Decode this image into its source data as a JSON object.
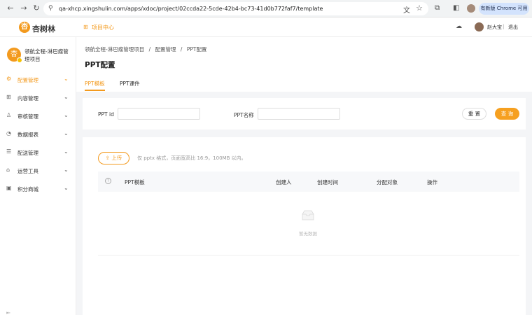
{
  "browser": {
    "url": "qa-xhcp.xingshulin.com/apps/xdoc/project/02ccda22-5cde-42b4-bc73-41d0b772faf7/template",
    "new_version": "有新版 Chrome 可用"
  },
  "header": {
    "brand": "杏树林",
    "project_center": "项目中心",
    "user_name": "赵大宝",
    "separator": "|",
    "logout": "退出"
  },
  "sidebar": {
    "project_name": "领航全程-淋巴瘤管理项目",
    "items": [
      {
        "label": "配置管理",
        "icon": "gear-icon",
        "active": true
      },
      {
        "label": "内容管理",
        "icon": "grid-icon",
        "active": false
      },
      {
        "label": "审核管理",
        "icon": "user-icon",
        "active": false
      },
      {
        "label": "数据报表",
        "icon": "pie-icon",
        "active": false
      },
      {
        "label": "配送管理",
        "icon": "list-icon",
        "active": false
      },
      {
        "label": "运营工具",
        "icon": "home-icon",
        "active": false
      },
      {
        "label": "积分商城",
        "icon": "store-icon",
        "active": false
      }
    ]
  },
  "main": {
    "breadcrumb": [
      "领航全程-淋巴瘤管理项目",
      "/",
      "配置管理",
      "/",
      "PPT配置"
    ],
    "title": "PPT配置",
    "tabs": [
      {
        "label": "PPT模板",
        "active": true
      },
      {
        "label": "PPT课件",
        "active": false
      }
    ],
    "filters": {
      "ppt_id_label": "PPT id",
      "ppt_id_value": "",
      "ppt_name_label": "PPT名称",
      "ppt_name_value": "",
      "reset_label": "重 置",
      "query_label": "查 询"
    },
    "upload": {
      "button_label": "上传",
      "hint": "仅 pptx 格式，页面宽高比 16:9，100MB 以内。"
    },
    "table": {
      "columns": [
        "PPT模板",
        "创建人",
        "创建时间",
        "分配对象",
        "操作"
      ],
      "help_glyph": "?",
      "rows": [],
      "empty_text": "暂无数据"
    }
  },
  "colors": {
    "accent": "#f39a1e",
    "query_button": "#f6a020"
  }
}
